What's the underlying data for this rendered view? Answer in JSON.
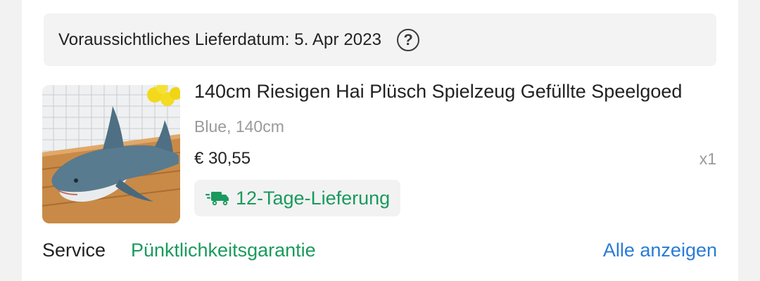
{
  "delivery": {
    "text": "Voraussichtliches Lieferdatum: 5. Apr 2023",
    "help_icon": "question-circle-icon"
  },
  "product": {
    "title": "140cm Riesigen Hai Plüsch Spielzeug Gefüllte Speelgoed",
    "variant": "Blue, 140cm",
    "price": "€ 30,55",
    "quantity": "x1",
    "shipping_label": "12-Tage-Lieferung",
    "shipping_icon": "truck-fast-icon"
  },
  "service": {
    "label": "Service",
    "value": "Pünktlichkeitsgarantie",
    "show_all": "Alle anzeigen"
  },
  "colors": {
    "green": "#1a9a5d",
    "link_blue": "#2a7bd6",
    "muted": "#9a9a9a",
    "text": "#222222"
  }
}
